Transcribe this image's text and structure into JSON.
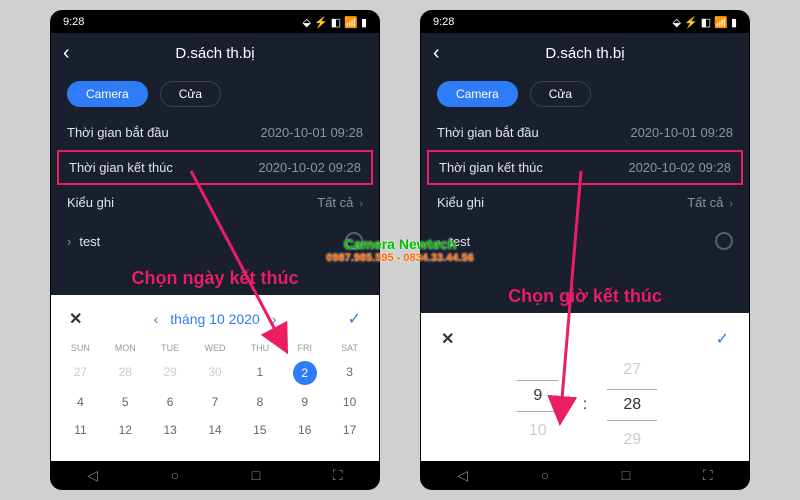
{
  "status": {
    "time": "9:28",
    "icons": "⬙ ⚡ ◧ 📶 ▮"
  },
  "header": {
    "title": "D.sách th.bị"
  },
  "tabs": {
    "camera": "Camera",
    "cua": "Cửa"
  },
  "startTime": {
    "label": "Thời gian bắt đầu",
    "value": "2020-10-01 09:28"
  },
  "endTime": {
    "label": "Thời gian kết thúc",
    "value": "2020-10-02 09:28"
  },
  "recordType": {
    "label": "Kiểu ghi",
    "value": "Tất cả"
  },
  "testItem": {
    "label": "test"
  },
  "annotations": {
    "left": "Chọn ngày kết thúc",
    "right": "Chọn giờ kết thúc"
  },
  "calendar": {
    "month": "tháng 10 2020",
    "weekdays": [
      "SUN",
      "MON",
      "TUE",
      "WED",
      "THU",
      "FRI",
      "SAT"
    ],
    "prevDays": [
      "27",
      "28",
      "29",
      "30"
    ],
    "days": [
      "1",
      "2",
      "3",
      "4",
      "5",
      "6",
      "7",
      "8",
      "9",
      "10",
      "11",
      "12",
      "13",
      "14",
      "15",
      "16",
      "17"
    ],
    "selectedDay": "2"
  },
  "timePicker": {
    "hourPrev": "",
    "hour": "9",
    "hourNext": "10",
    "minPrev": "27",
    "min": "28",
    "minNext": "29"
  },
  "watermark": {
    "title": "Camera Newtech",
    "phone": "0987.985.595 - 0834.33.44.56"
  },
  "nav": {
    "back": "◁",
    "home": "○",
    "recent": "□",
    "access": "⛶"
  }
}
